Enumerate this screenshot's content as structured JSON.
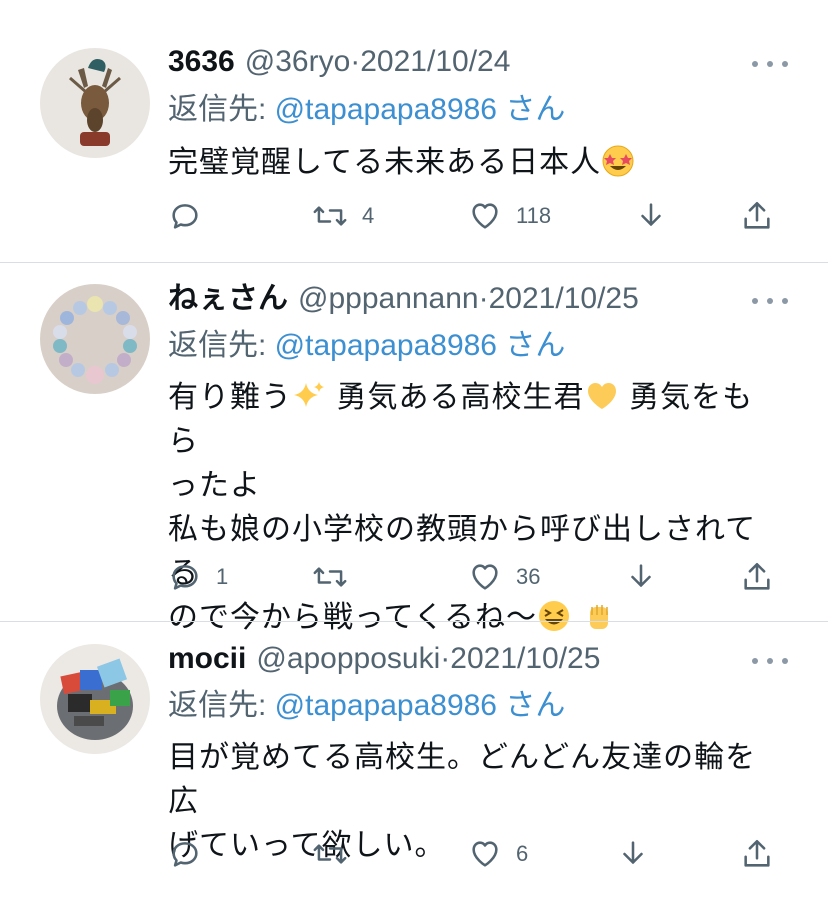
{
  "tweets": [
    {
      "display_name": "3636",
      "handle": "@36ryo",
      "separator": "·",
      "date": "2021/10/24",
      "reply_prefix": "返信先: ",
      "reply_to": "@tapapapa8986",
      "reply_suffix": " さん",
      "lines": [
        "完璧覚醒してる未来ある日本人"
      ],
      "emoji": [
        "star-struck-emoji"
      ],
      "reply_count": "",
      "retweet_count": "4",
      "like_count": "118",
      "avatar_icon": "deer-head-avatar"
    },
    {
      "display_name": "ねぇさん",
      "handle": "@pppannann",
      "separator": "·",
      "date": "2021/10/25",
      "reply_prefix": "返信先: ",
      "reply_to": "@tapapapa8986",
      "reply_suffix": " さん",
      "line1_a": "有り難う",
      "line1_b": " 勇気ある高校生君",
      "line1_c": " 勇気をもら",
      "line2": "ったよ",
      "line3": "私も娘の小学校の教頭から呼び出しされてる",
      "line4": "ので今から戦ってくるね〜",
      "emoji": [
        "sparkles-emoji",
        "yellow-heart-emoji",
        "grinning-squinting-emoji",
        "raised-fist-emoji"
      ],
      "reply_count": "1",
      "retweet_count": "",
      "like_count": "36",
      "avatar_icon": "bead-bracelet-avatar"
    },
    {
      "display_name": "mocii",
      "handle": "@apopposuki",
      "separator": "·",
      "date": "2021/10/25",
      "reply_prefix": "返信先: ",
      "reply_to": "@tapapapa8986",
      "reply_suffix": " さん",
      "line1": "目が覚めてる高校生。どんどん友達の輪を広",
      "line2": "げていって欲しい。",
      "reply_count": "",
      "retweet_count": "",
      "like_count": "6",
      "avatar_icon": "colorful-object-avatar"
    }
  ],
  "colors": {
    "text": "#0f1419",
    "secondary": "#536471",
    "link": "#3c8fd1",
    "divider": "#d9dee3"
  }
}
